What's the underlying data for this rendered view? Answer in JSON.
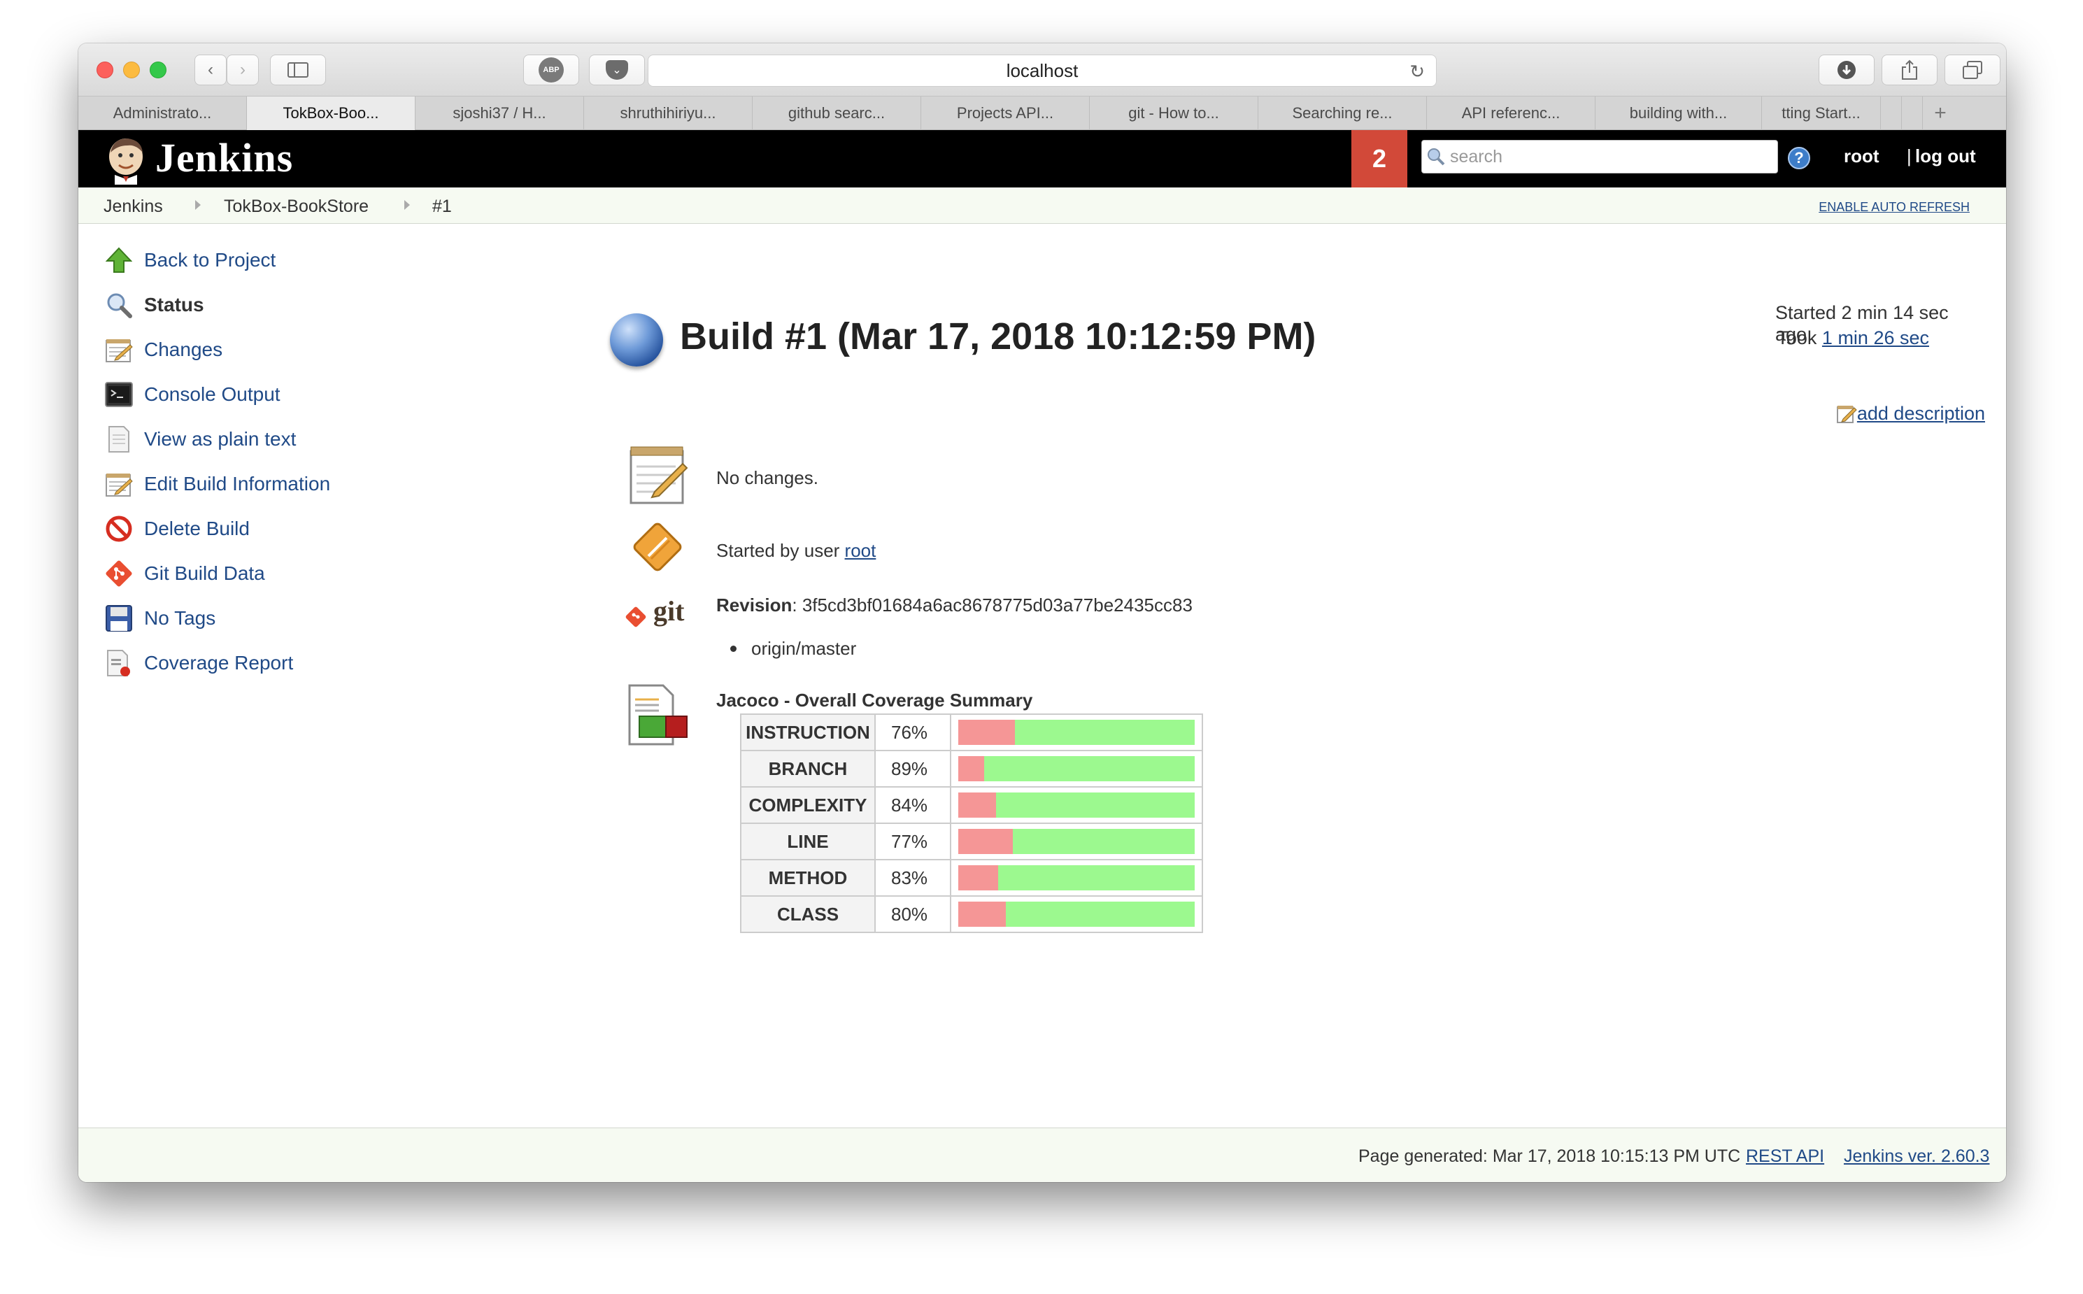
{
  "browser": {
    "address": "localhost",
    "tabs": [
      {
        "label": "Administrato..."
      },
      {
        "label": "TokBox-Boo..."
      },
      {
        "label": "sjoshi37 / H..."
      },
      {
        "label": "shruthihiriyu..."
      },
      {
        "label": "github searc..."
      },
      {
        "label": "Projects API..."
      },
      {
        "label": "git - How to..."
      },
      {
        "label": "Searching re..."
      },
      {
        "label": "API referenc..."
      },
      {
        "label": "building with..."
      },
      {
        "label": "tting Start..."
      }
    ],
    "abp_label": "ABP"
  },
  "header": {
    "logo_text": "Jenkins",
    "notification_count": "2",
    "search_placeholder": "search",
    "help": "?",
    "user": "root",
    "separator": "|",
    "logout": "log out"
  },
  "breadcrumb": {
    "items": [
      "Jenkins",
      "TokBox-BookStore",
      "#1"
    ],
    "auto_refresh": "ENABLE AUTO REFRESH"
  },
  "sidebar": {
    "items": [
      {
        "label": "Back to Project",
        "icon": "up-arrow-icon"
      },
      {
        "label": "Status",
        "icon": "magnifier-icon"
      },
      {
        "label": "Changes",
        "icon": "notepad-icon"
      },
      {
        "label": "Console Output",
        "icon": "terminal-icon"
      },
      {
        "label": "View as plain text",
        "icon": "document-icon"
      },
      {
        "label": "Edit Build Information",
        "icon": "notepad-icon"
      },
      {
        "label": "Delete Build",
        "icon": "no-entry-icon"
      },
      {
        "label": "Git Build Data",
        "icon": "git-icon"
      },
      {
        "label": "No Tags",
        "icon": "floppy-disk-icon"
      },
      {
        "label": "Coverage Report",
        "icon": "report-icon"
      }
    ]
  },
  "build": {
    "title": "Build #1 (Mar 17, 2018 10:12:59 PM)",
    "started": "Started 2 min 14 sec ago",
    "took_prefix": "Took",
    "took_link": "1 min 26 sec",
    "add_description": "add description",
    "changes": "No changes.",
    "started_by_prefix": "Started by user",
    "started_by_user": "root",
    "revision_label": "Revision",
    "revision_value": ": 3f5cd3bf01684a6ac8678775d03a77be2435cc83",
    "git_icon_text": "git",
    "branch": "origin/master"
  },
  "coverage": {
    "title": "Jacoco - Overall Coverage Summary",
    "colors": {
      "covered": "#9cf98f",
      "missed": "#f59696"
    },
    "rows": [
      {
        "name": "INSTRUCTION",
        "percent": "76%",
        "value": 76
      },
      {
        "name": "BRANCH",
        "percent": "89%",
        "value": 89
      },
      {
        "name": "COMPLEXITY",
        "percent": "84%",
        "value": 84
      },
      {
        "name": "LINE",
        "percent": "77%",
        "value": 77
      },
      {
        "name": "METHOD",
        "percent": "83%",
        "value": 83
      },
      {
        "name": "CLASS",
        "percent": "80%",
        "value": 80
      }
    ]
  },
  "footer": {
    "generated": "Page generated: Mar 17, 2018 10:15:13 PM UTC",
    "rest_api": "REST API",
    "version": "Jenkins ver. 2.60.3"
  }
}
